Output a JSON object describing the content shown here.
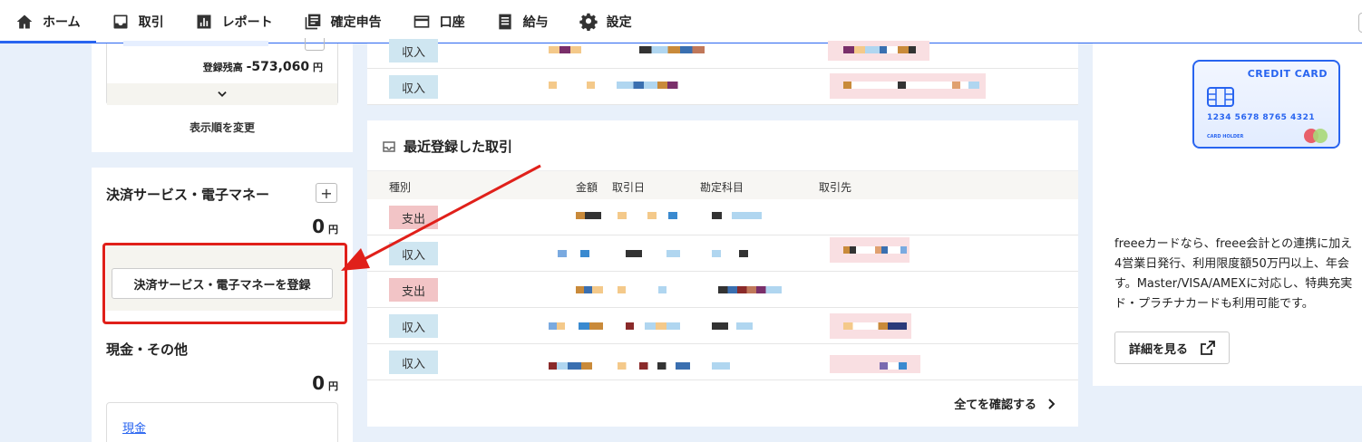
{
  "nav": {
    "items": [
      {
        "label": "ホーム",
        "icon": "home-icon"
      },
      {
        "label": "取引",
        "icon": "inbox-icon"
      },
      {
        "label": "レポート",
        "icon": "bar-chart-icon"
      },
      {
        "label": "確定申告",
        "icon": "library-icon"
      },
      {
        "label": "口座",
        "icon": "card-icon"
      },
      {
        "label": "給与",
        "icon": "document-icon"
      },
      {
        "label": "設定",
        "icon": "gear-icon"
      }
    ],
    "active": "ホーム"
  },
  "accounts_panel": {
    "balance_label": "登録残高",
    "balance_value": "-573,060",
    "currency": "円",
    "reorder_label": "表示順を変更"
  },
  "payment_section": {
    "title": "決済サービス・電子マネー",
    "amount": "0",
    "currency": "円",
    "register_button": "決済サービス・電子マネーを登録"
  },
  "cash_section": {
    "title": "現金・その他",
    "amount": "0",
    "currency": "円",
    "link": "現金"
  },
  "upper_rows": [
    {
      "type": "収入"
    },
    {
      "type": "収入"
    }
  ],
  "recent": {
    "title": "最近登録した取引",
    "headers": {
      "type": "種別",
      "amount": "金額",
      "date": "取引日",
      "account": "勘定科目",
      "partner": "取引先"
    },
    "rows": [
      {
        "type": "支出",
        "kind": "out"
      },
      {
        "type": "収入",
        "kind": "in"
      },
      {
        "type": "支出",
        "kind": "out"
      },
      {
        "type": "収入",
        "kind": "in"
      },
      {
        "type": "収入",
        "kind": "in"
      }
    ],
    "see_all": "全てを確認する"
  },
  "promo": {
    "card_title": "CREDIT CARD",
    "card_number": "1234  5678  8765  4321",
    "card_holder": "CARD HOLDER",
    "lines": [
      "freeeカードなら、freee会計との連携に加え",
      "4営業日発行、利用限度額50万円以上、年会",
      "す。Master/VISA/AMEXに対応し、特典充実",
      "ド・プラチナカードも利用可能です。"
    ],
    "detail_button": "詳細を見る"
  },
  "colors": {
    "accent": "#2864f0",
    "annotation_red": "#e0201a",
    "income_badge": "#cfe6f1",
    "expense_badge": "#f2c4c6"
  }
}
